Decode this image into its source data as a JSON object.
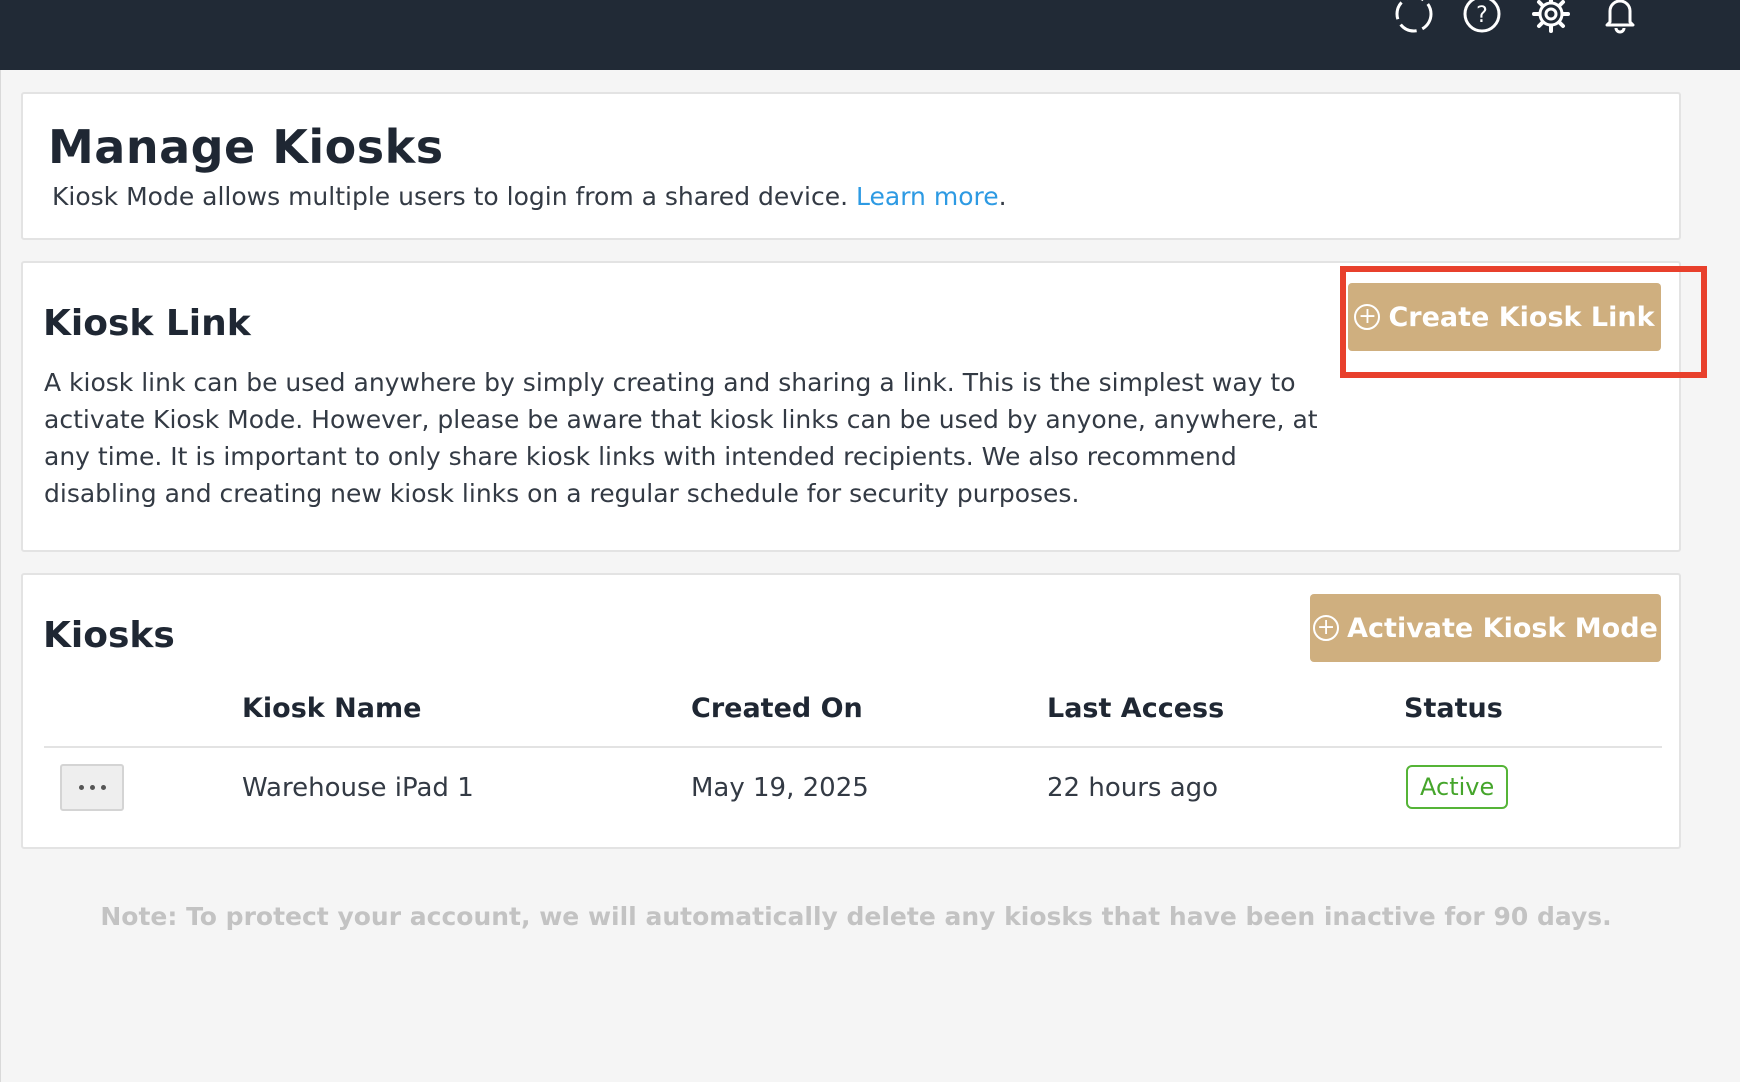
{
  "header": {
    "icons": [
      "loading-icon",
      "help-icon",
      "gear-icon",
      "bell-icon"
    ]
  },
  "page": {
    "title": "Manage Kiosks",
    "subtitle": "Kiosk Mode allows multiple users to login from a shared device.",
    "learn_more": "Learn more",
    "period": "."
  },
  "kiosk_link": {
    "title": "Kiosk Link",
    "description": "A kiosk link can be used anywhere by simply creating and sharing a link. This is the simplest way to activate Kiosk Mode. However, please be aware that kiosk links can be used by anyone, anywhere, at any time. It is important to only share kiosk links with intended recipients. We also recommend disabling and creating new kiosk links on a regular schedule for security purposes.",
    "button_label": "Create Kiosk Link"
  },
  "kiosks": {
    "title": "Kiosks",
    "button_label": "Activate Kiosk Mode",
    "columns": [
      "Kiosk Name",
      "Created On",
      "Last Access",
      "Status"
    ],
    "rows": [
      {
        "name": "Warehouse iPad 1",
        "created_on": "May 19, 2025",
        "last_access": "22 hours ago",
        "status": "Active"
      }
    ]
  },
  "note": "Note: To protect your account, we will automatically delete any kiosks that have been inactive for 90 days.",
  "colors": {
    "topbar": "#212a36",
    "button": "#cfaf7f",
    "link": "#2d9ae3",
    "highlight": "#e8402c",
    "status_active": "#45a52b"
  }
}
